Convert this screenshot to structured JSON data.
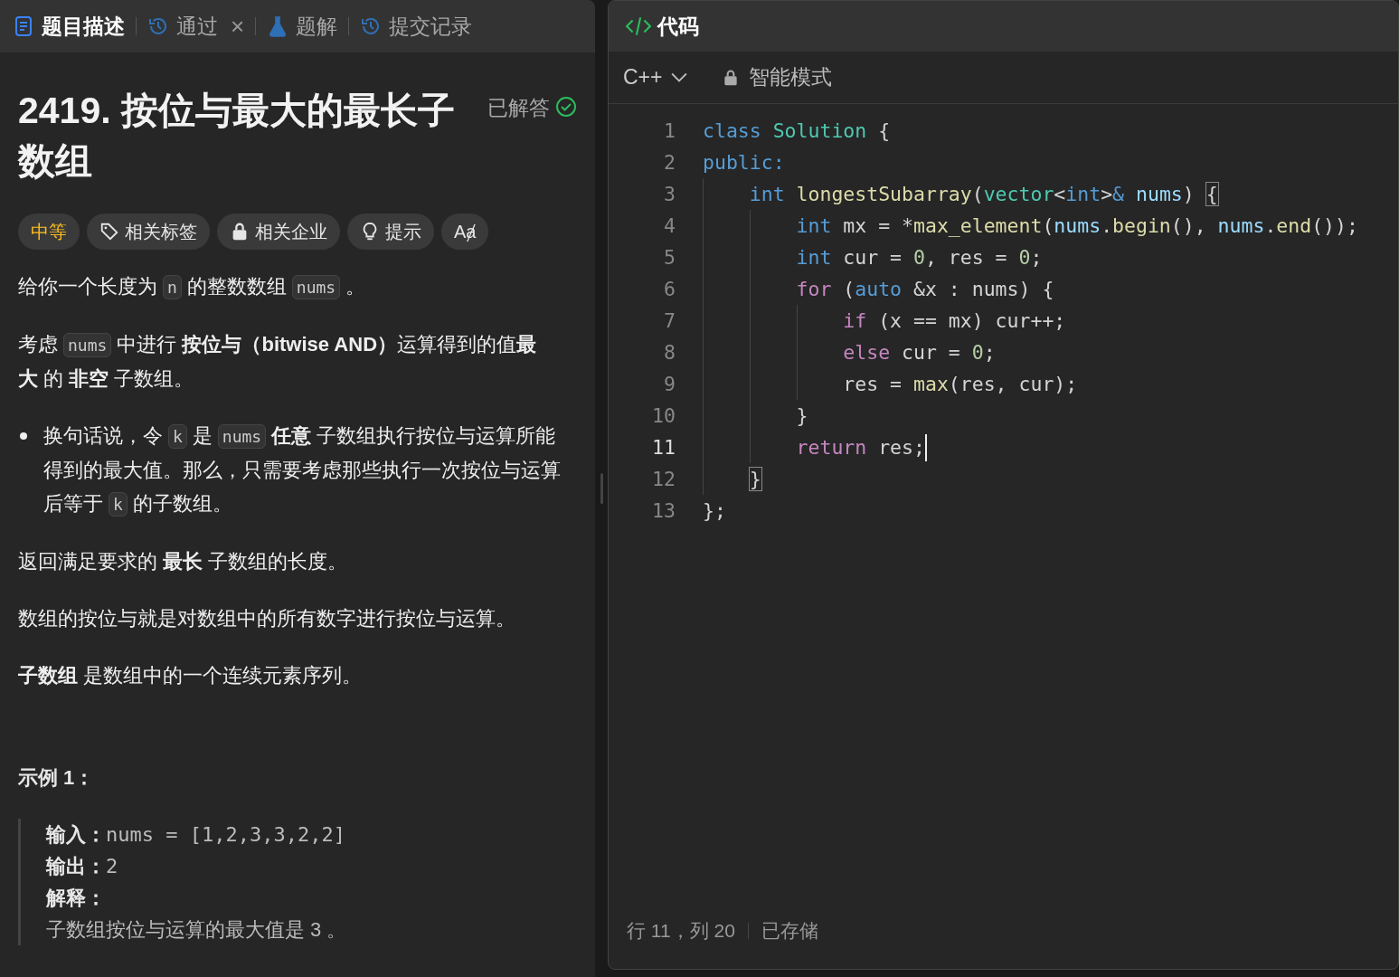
{
  "left_tabs": [
    {
      "label": "题目描述",
      "selected": true,
      "closable": false
    },
    {
      "label": "通过",
      "selected": false,
      "closable": true,
      "close_label": "×"
    },
    {
      "label": "题解",
      "selected": false,
      "closable": false
    },
    {
      "label": "提交记录",
      "selected": false,
      "closable": false
    }
  ],
  "problem": {
    "title": "2419. 按位与最大的最长子数组",
    "status": "已解答",
    "tags": [
      {
        "label": "中等",
        "kind": "difficulty"
      },
      {
        "label": "相关标签",
        "kind": "chip"
      },
      {
        "label": "相关企业",
        "kind": "chip"
      },
      {
        "label": "提示",
        "kind": "chip"
      },
      {
        "label": "Aⱥ",
        "kind": "chip"
      }
    ],
    "blocks": [
      {
        "kind": "para",
        "segments": [
          {
            "kind": "text",
            "text": "给你一个长度为"
          },
          {
            "kind": "code",
            "text": "n"
          },
          {
            "kind": "text",
            "text": "的整数数组"
          },
          {
            "kind": "code",
            "text": "nums"
          },
          {
            "kind": "text",
            "text": "。"
          }
        ]
      },
      {
        "kind": "para",
        "segments": [
          {
            "kind": "text",
            "text": "考虑"
          },
          {
            "kind": "code",
            "text": "nums"
          },
          {
            "kind": "text",
            "text": "中进行 **按位与（bitwise AND）**运算得到的值**最大** 的 **非空** 子数组。"
          }
        ]
      },
      {
        "kind": "bullet",
        "segments": [
          {
            "kind": "text",
            "text": "换句话说，令"
          },
          {
            "kind": "code",
            "text": "k"
          },
          {
            "kind": "text",
            "text": "是"
          },
          {
            "kind": "code",
            "text": "nums"
          },
          {
            "kind": "text",
            "text": "**任意** 子数组执行按位与运算所能得到的最大值。那么，只需要考虑那些执行一次按位与运算后等于"
          },
          {
            "kind": "code",
            "text": "k"
          },
          {
            "kind": "text",
            "text": "的子数组。"
          }
        ]
      },
      {
        "kind": "para",
        "segments": [
          {
            "kind": "text",
            "text": "返回满足要求的 **最长** 子数组的长度。"
          }
        ]
      },
      {
        "kind": "para",
        "segments": [
          {
            "kind": "text",
            "text": "数组的按位与就是对数组中的所有数字进行按位与运算。"
          }
        ]
      },
      {
        "kind": "para",
        "segments": [
          {
            "kind": "text",
            "text": "**子数组** 是数组中的一个连续元素序列。"
          }
        ]
      }
    ],
    "example": {
      "title": "示例 1：",
      "lines": [
        {
          "label": "输入：",
          "value": "nums = [1,2,3,3,2,2]"
        },
        {
          "label": "输出：",
          "value": "2"
        },
        {
          "label": "解释："
        }
      ],
      "explanation": "子数组按位与运算的最大值是 3 。"
    }
  },
  "editor": {
    "tab": {
      "label": "代码"
    },
    "language": "C++",
    "mode": "智能模式",
    "lines": [
      {
        "number": "1",
        "selected": false,
        "tokens": [
          {
            "kind": "keyword",
            "text": "class"
          },
          {
            "kind": "class",
            "text": " Solution"
          },
          {
            "kind": "plain",
            "text": " {"
          }
        ]
      },
      {
        "number": "2",
        "selected": false,
        "tokens": [
          {
            "kind": "keyword",
            "text": "public:"
          }
        ]
      },
      {
        "number": "3",
        "selected": false,
        "tokens": [
          {
            "kind": "keyword",
            "text": "    int"
          },
          {
            "kind": "func",
            "text": " longestSubarray"
          },
          {
            "kind": "plain",
            "text": "("
          },
          {
            "kind": "class",
            "text": "vector"
          },
          {
            "kind": "plain",
            "text": "<"
          },
          {
            "kind": "keyword",
            "text": "int"
          },
          {
            "kind": "plain",
            "text": ">"
          },
          {
            "kind": "keyword",
            "text": "&"
          },
          {
            "kind": "var",
            "text": " nums"
          },
          {
            "kind": "plain",
            "text": ") "
          },
          {
            "kind": "bracket",
            "text": "{"
          }
        ]
      },
      {
        "number": "4",
        "selected": false,
        "tokens": [
          {
            "kind": "keyword",
            "text": "        int"
          },
          {
            "kind": "plain",
            "text": " mx = *"
          },
          {
            "kind": "func",
            "text": "max_element"
          },
          {
            "kind": "plain",
            "text": "("
          },
          {
            "kind": "var",
            "text": "nums"
          },
          {
            "kind": "plain",
            "text": "."
          },
          {
            "kind": "func",
            "text": "begin"
          },
          {
            "kind": "plain",
            "text": "(), "
          },
          {
            "kind": "var",
            "text": "nums"
          },
          {
            "kind": "plain",
            "text": "."
          },
          {
            "kind": "func",
            "text": "end"
          },
          {
            "kind": "plain",
            "text": "());"
          }
        ]
      },
      {
        "number": "5",
        "selected": false,
        "tokens": [
          {
            "kind": "keyword",
            "text": "        int"
          },
          {
            "kind": "plain",
            "text": " cur = "
          },
          {
            "kind": "number",
            "text": "0"
          },
          {
            "kind": "plain",
            "text": ", res = "
          },
          {
            "kind": "number",
            "text": "0"
          },
          {
            "kind": "plain",
            "text": ";"
          }
        ]
      },
      {
        "number": "6",
        "selected": false,
        "tokens": [
          {
            "kind": "control",
            "text": "        for"
          },
          {
            "kind": "plain",
            "text": " ("
          },
          {
            "kind": "keyword",
            "text": "auto"
          },
          {
            "kind": "plain",
            "text": " &x : nums) {"
          }
        ]
      },
      {
        "number": "7",
        "selected": false,
        "tokens": [
          {
            "kind": "control",
            "text": "            if"
          },
          {
            "kind": "plain",
            "text": " (x == mx) cur++;"
          }
        ]
      },
      {
        "number": "8",
        "selected": false,
        "tokens": [
          {
            "kind": "control",
            "text": "            else"
          },
          {
            "kind": "plain",
            "text": " cur = "
          },
          {
            "kind": "number",
            "text": "0"
          },
          {
            "kind": "plain",
            "text": ";"
          }
        ]
      },
      {
        "number": "9",
        "selected": false,
        "tokens": [
          {
            "kind": "plain",
            "text": "            res = "
          },
          {
            "kind": "func",
            "text": "max"
          },
          {
            "kind": "plain",
            "text": "(res, cur);"
          }
        ]
      },
      {
        "number": "10",
        "selected": false,
        "tokens": [
          {
            "kind": "plain",
            "text": "        }"
          }
        ]
      },
      {
        "number": "11",
        "selected": true,
        "tokens": [
          {
            "kind": "control",
            "text": "        return"
          },
          {
            "kind": "plain",
            "text": " res;"
          }
        ]
      },
      {
        "number": "12",
        "selected": false,
        "tokens": [
          {
            "kind": "bracket",
            "text": "    }"
          }
        ]
      },
      {
        "number": "13",
        "selected": false,
        "tokens": [
          {
            "kind": "plain",
            "text": "};"
          }
        ]
      }
    ],
    "status": {
      "position": "行 11，列 20",
      "saved": "已存储"
    }
  }
}
